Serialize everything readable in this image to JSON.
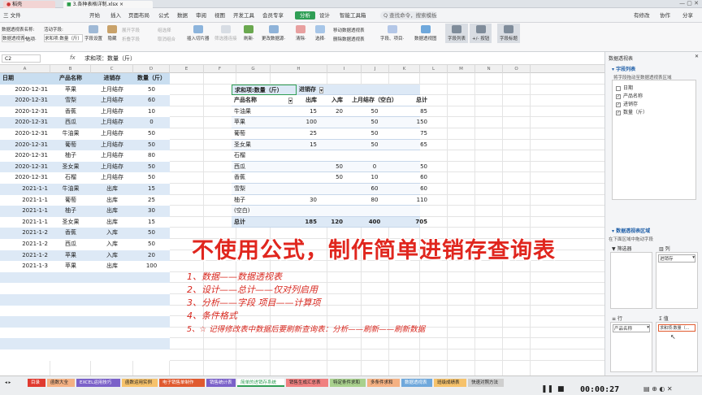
{
  "tabs": [
    {
      "label": "稻壳"
    },
    {
      "label": "3.各种表格详制.xlsx"
    }
  ],
  "titlebar_right": "",
  "menu": [
    "三 文件",
    "开始",
    "插入",
    "页面布局",
    "公式",
    "数据",
    "审阅",
    "视图",
    "开发工具",
    "会员专享",
    "分析",
    "设计",
    "智能工具箱"
  ],
  "search_placeholder": "Q 查找命令，搜索模板",
  "user_actions": [
    "有修改",
    "协作",
    "分享"
  ],
  "ribbon": {
    "field_name_label": "数据透视表名称:",
    "pivot_name": "数据透视表4",
    "options": "选项·",
    "active_field_label": "活动字段:",
    "active_field": "求和项:数量（斤）",
    "field_settings": "字段设置",
    "hide": "隐藏",
    "expand": "展开字段",
    "collapse": "折叠字段",
    "group_sel": "组选择",
    "ungroup": "取消组合",
    "insert_slicer": "插入切片器",
    "filter_conn": "筛选器连接",
    "refresh": "刷新·",
    "change_source": "更改数据源·",
    "clear": "清除·",
    "select": "选择·",
    "move_pivot": "移动数据透视表",
    "delete_pivot": "删除数据透视表",
    "fields_items": "字段、项目·",
    "pivot_chart": "数据透视图",
    "field_list": "字段列表",
    "plus_minus": "+/- 按钮",
    "field_header": "字段标题"
  },
  "formula_bar": {
    "name_box": "C2",
    "fx": "fx",
    "value": "求和项：数量（斤）"
  },
  "columns": [
    "A",
    "B",
    "C",
    "D",
    "E",
    "F",
    "G",
    "H",
    "I",
    "J",
    "K",
    "L",
    "M",
    "N",
    "O"
  ],
  "source_header": {
    "date": "日期",
    "product": "产品名称",
    "type": "进销存",
    "qty": "数量（斤）"
  },
  "source_rows": [
    {
      "date": "2020-12-31",
      "product": "苹果",
      "type": "上月结存",
      "qty": "50"
    },
    {
      "date": "2020-12-31",
      "product": "雪梨",
      "type": "上月结存",
      "qty": "60"
    },
    {
      "date": "2020-12-31",
      "product": "香蕉",
      "type": "上月结存",
      "qty": "10"
    },
    {
      "date": "2020-12-31",
      "product": "西瓜",
      "type": "上月结存",
      "qty": "0"
    },
    {
      "date": "2020-12-31",
      "product": "牛油果",
      "type": "上月结存",
      "qty": "50"
    },
    {
      "date": "2020-12-31",
      "product": "葡萄",
      "type": "上月结存",
      "qty": "50"
    },
    {
      "date": "2020-12-31",
      "product": "柚子",
      "type": "上月结存",
      "qty": "80"
    },
    {
      "date": "2020-12-31",
      "product": "圣女果",
      "type": "上月结存",
      "qty": "50"
    },
    {
      "date": "2020-12-31",
      "product": "石榴",
      "type": "上月结存",
      "qty": "50"
    },
    {
      "date": "2021-1-1",
      "product": "牛油果",
      "type": "出库",
      "qty": "15"
    },
    {
      "date": "2021-1-1",
      "product": "葡萄",
      "type": "出库",
      "qty": "25"
    },
    {
      "date": "2021-1-1",
      "product": "柚子",
      "type": "出库",
      "qty": "30"
    },
    {
      "date": "2021-1-1",
      "product": "圣女果",
      "type": "出库",
      "qty": "15"
    },
    {
      "date": "2021-1-2",
      "product": "香蕉",
      "type": "入库",
      "qty": "50"
    },
    {
      "date": "2021-1-2",
      "product": "西瓜",
      "type": "入库",
      "qty": "50"
    },
    {
      "date": "2021-1-2",
      "product": "苹果",
      "type": "入库",
      "qty": "20"
    },
    {
      "date": "2021-1-3",
      "product": "苹果",
      "type": "出库",
      "qty": "100"
    }
  ],
  "pivot": {
    "corner": "求和项:数量（斤）",
    "col_field": "进销存",
    "row_field": "产品名称",
    "headers": [
      "出库",
      "入库",
      "上月结存（空白）",
      "总计"
    ],
    "rows": [
      {
        "name": "牛油果",
        "out": "15",
        "in": "20",
        "prev": "50",
        "total": "85"
      },
      {
        "name": "苹果",
        "out": "100",
        "in": "",
        "prev": "50",
        "total": "150"
      },
      {
        "name": "葡萄",
        "out": "25",
        "in": "",
        "prev": "50",
        "total": "75"
      },
      {
        "name": "圣女果",
        "out": "15",
        "in": "",
        "prev": "50",
        "total": "65"
      },
      {
        "name": "石榴",
        "out": "",
        "in": "",
        "prev": "",
        "total": ""
      },
      {
        "name": "西瓜",
        "out": "",
        "in": "50",
        "prev": "0",
        "total": "50"
      },
      {
        "name": "香蕉",
        "out": "",
        "in": "50",
        "prev": "10",
        "total": "60"
      },
      {
        "name": "雪梨",
        "out": "",
        "in": "",
        "prev": "60",
        "total": "60"
      },
      {
        "name": "柚子",
        "out": "30",
        "in": "",
        "prev": "80",
        "total": "110"
      },
      {
        "name": "(空白)",
        "out": "",
        "in": "",
        "prev": "",
        "total": ""
      }
    ],
    "total": {
      "name": "总计",
      "out": "185",
      "in": "120",
      "prev": "400",
      "total": "705"
    }
  },
  "overlay": {
    "title": "不使用公式，制作简单进销存查询表",
    "steps": [
      "1、数据——数据透视表",
      "2、设计——总计——仅对列启用",
      "3、分析——字段 项目——计算项",
      "4、条件格式",
      "5、☆ 记得修改表中数据后要刷新查询表：分析——刷新——刷新数据"
    ]
  },
  "pane": {
    "title": "数据透视表",
    "field_list": "字段列表",
    "hint": "将字段拖动至数据透视表区域",
    "fields": [
      {
        "label": "日期",
        "checked": false
      },
      {
        "label": "产品名称",
        "checked": true
      },
      {
        "label": "进销存",
        "checked": true
      },
      {
        "label": "数量（斤）",
        "checked": true
      }
    ],
    "areas_title": "数据透视表区域",
    "areas_hint": "在下面区域中拖动字段",
    "filter": "筛选器",
    "columns": "列",
    "rows": "行",
    "values": "值",
    "col_item": "进销存",
    "row_item": "产品名称",
    "val_item": "求和项:数量（..."
  },
  "sheet_tabs": [
    "目录",
    "函数大全",
    "EXCEL运用技巧",
    "函数运用实例",
    "电子销售单制作",
    "销售统计表",
    "简单的进销存系统",
    "销售生成汇总表",
    "特定条件求和",
    "多条件求和",
    "数据透视表",
    "班级成绩表",
    "快速对照方法"
  ],
  "sheet_tab_colors": [
    "#e03a2f",
    "#f4b183",
    "#7b61c9",
    "#f6c26b",
    "#e05a2f",
    "#7b61c9",
    "#ffffff",
    "#f08080",
    "#a8d08d",
    "#f4b183",
    "#6fa8dc",
    "#f6c26b",
    "#cfcfcf"
  ],
  "video": {
    "time": "00:00:27"
  }
}
